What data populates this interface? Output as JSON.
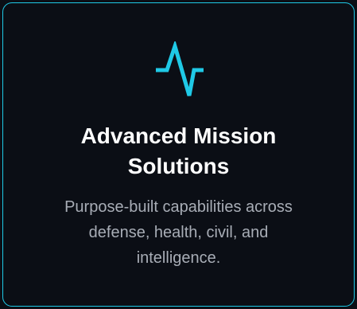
{
  "card": {
    "icon": "activity-pulse-icon",
    "title_line_1": "Advanced Mission",
    "title_line_2": "Solutions",
    "description_line_1": "Purpose-built capabilities across",
    "description_line_2": "defense, health, civil, and",
    "description_line_3": "intelligence."
  },
  "colors": {
    "accent": "#1fc9e6",
    "background": "#0b0e15",
    "title": "#ffffff",
    "description": "#a8adb6"
  }
}
